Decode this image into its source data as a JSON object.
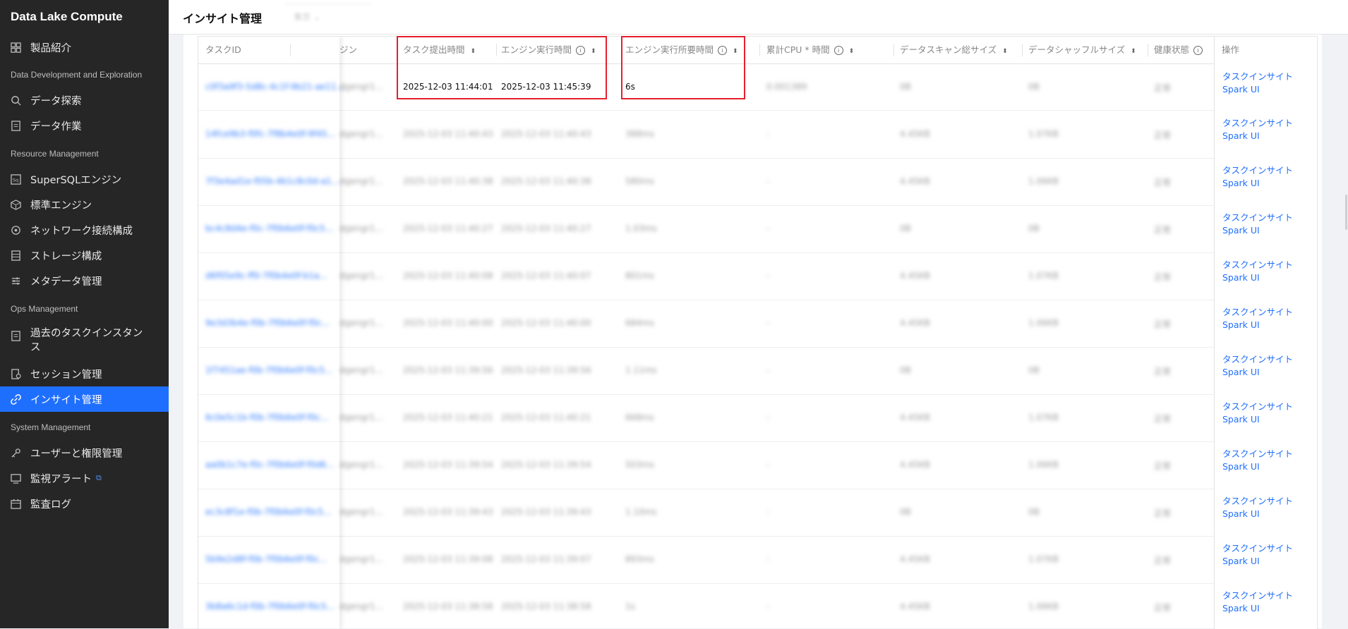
{
  "sidebar": {
    "brand": "Data Lake Compute",
    "sections": {
      "dev": "Data Development and Exploration",
      "resource": "Resource Management",
      "ops": "Ops Management",
      "system": "System Management"
    },
    "items": {
      "product_intro": "製品紹介",
      "data_explore": "データ探索",
      "data_jobs": "データ作業",
      "supersql": "SuperSQLエンジン",
      "standard_engine": "標準エンジン",
      "network": "ネットワーク接続構成",
      "storage": "ストレージ構成",
      "metadata": "メタデータ管理",
      "history": "過去のタスクインスタンス",
      "session": "セッション管理",
      "insight": "インサイト管理",
      "users": "ユーザーと権限管理",
      "alerts": "監視アラート",
      "audit": "監査ログ"
    }
  },
  "header": {
    "title": "インサイト管理",
    "region": "東京"
  },
  "table": {
    "columns": {
      "task_id": "タスクID",
      "engine": "ジン",
      "submit_time": "タスク提出時間",
      "exec_time": "エンジン実行時間",
      "duration": "エンジン実行所要時間",
      "cpu": "累計CPU * 時間",
      "scan": "データスキャン総サイズ",
      "shuffle": "データシャッフルサイズ",
      "health": "健康状態",
      "ops": "操作"
    },
    "op_insight": "タスクインサイト",
    "op_spark": "Spark UI",
    "rows": [
      {
        "task_id": "c0f3a9f3-5d8c-4c1f-9b21-ae11...",
        "engine": "dgengr1...",
        "submit": "2025-12-03 11:44:01",
        "exec": "2025-12-03 11:45:39",
        "dur": "6s",
        "cpu": "0.001389",
        "scan": "0B",
        "shuffle": "0B",
        "health": "正常"
      },
      {
        "task_id": "14fce9b3-f0fc-7f8b4e0f-9f45...",
        "engine": "dgengr1...",
        "submit": "2025-12-03 11:40:43",
        "exec": "2025-12-03 11:40:43",
        "dur": "388ms",
        "cpu": "-",
        "scan": "4.45KB",
        "shuffle": "1.07KB",
        "health": "正常"
      },
      {
        "task_id": "7f3e4ad1e-f05b-4b1c8c0d-a1...",
        "engine": "dgengr1...",
        "submit": "2025-12-03 11:40:38",
        "exec": "2025-12-03 11:40:38",
        "dur": "580ms",
        "cpu": "-",
        "scan": "4.45KB",
        "shuffle": "1.06KB",
        "health": "正常"
      },
      {
        "task_id": "bc4c8d4e-f0c-7f0b6e0f-f0c5...",
        "engine": "dgengr1...",
        "submit": "2025-12-03 11:40:27",
        "exec": "2025-12-03 11:40:27",
        "dur": "1.03ms",
        "cpu": "-",
        "scan": "0B",
        "shuffle": "0B",
        "health": "正常"
      },
      {
        "task_id": "d6f05e9c-ff0-7f0b4e0f-b1a...",
        "engine": "dgengr1...",
        "submit": "2025-12-03 11:40:08",
        "exec": "2025-12-03 11:40:07",
        "dur": "801ms",
        "cpu": "-",
        "scan": "4.45KB",
        "shuffle": "1.07KB",
        "health": "正常"
      },
      {
        "task_id": "9e3d3b4e-f0b-7f0b6e0f-f0c...",
        "engine": "dgengr1...",
        "submit": "2025-12-03 11:40:00",
        "exec": "2025-12-03 11:40:00",
        "dur": "684ms",
        "cpu": "-",
        "scan": "4.45KB",
        "shuffle": "1.06KB",
        "health": "正常"
      },
      {
        "task_id": "1f7451ae-f0b-7f0b6e0f-f0c5...",
        "engine": "dgengr1...",
        "submit": "2025-12-03 11:39:56",
        "exec": "2025-12-03 11:39:56",
        "dur": "1.11ms",
        "cpu": "-",
        "scan": "0B",
        "shuffle": "0B",
        "health": "正常"
      },
      {
        "task_id": "6c0e5c1b-f0b-7f0b6e0f-f0c...",
        "engine": "dgengr1...",
        "submit": "2025-12-03 11:40:21",
        "exec": "2025-12-03 11:40:21",
        "dur": "668ms",
        "cpu": "-",
        "scan": "4.45KB",
        "shuffle": "1.07KB",
        "health": "正常"
      },
      {
        "task_id": "aa0b1c7e-f0c-7f0b6e0f-f0d6...",
        "engine": "dgengr1...",
        "submit": "2025-12-03 11:39:54",
        "exec": "2025-12-03 11:39:54",
        "dur": "503ms",
        "cpu": "-",
        "scan": "4.45KB",
        "shuffle": "1.06KB",
        "health": "正常"
      },
      {
        "task_id": "ec3c8f1e-f0b-7f0b6e0f-f0c5...",
        "engine": "dgengr1...",
        "submit": "2025-12-03 11:39:43",
        "exec": "2025-12-03 11:39:43",
        "dur": "1.10ms",
        "cpu": "-",
        "scan": "0B",
        "shuffle": "0B",
        "health": "正常"
      },
      {
        "task_id": "5b9e2d8f-f0b-7f0b6e0f-f0c...",
        "engine": "dgengr1...",
        "submit": "2025-12-03 11:39:08",
        "exec": "2025-12-03 11:39:07",
        "dur": "893ms",
        "cpu": "-",
        "scan": "4.45KB",
        "shuffle": "1.07KB",
        "health": "正常"
      },
      {
        "task_id": "3b8a6c1d-f0b-7f0b6e0f-f0c5...",
        "engine": "dgengr1...",
        "submit": "2025-12-03 11:38:58",
        "exec": "2025-12-03 11:38:58",
        "dur": "1s",
        "cpu": "-",
        "scan": "4.45KB",
        "shuffle": "1.06KB",
        "health": "正常"
      }
    ]
  }
}
